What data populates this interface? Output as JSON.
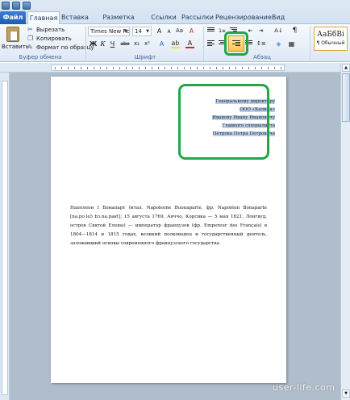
{
  "tabs": [
    "Файл",
    "Главная",
    "Вставка",
    "Разметка страницы",
    "Ссылки",
    "Рассылки",
    "Рецензирование",
    "Вид"
  ],
  "clipboard": {
    "paste": "Вставить",
    "cut": "Вырезать",
    "copy": "Копировать",
    "format": "Формат по образцу",
    "group": "Буфер обмена"
  },
  "font": {
    "name": "Times New Rom",
    "size": "14",
    "group": "Шрифт"
  },
  "paragraph": {
    "group": "Абзац"
  },
  "styles": {
    "sample": "АаБбВі",
    "name": "¶ Обычный"
  },
  "icons": {
    "bold": "Ж",
    "italic": "К",
    "underline": "Ч",
    "strike": "abe",
    "subscript": "x₂",
    "superscript": "x²",
    "pilcrow": "¶",
    "grow": "A",
    "shrink": "A",
    "case": "Aa",
    "clear": "A"
  },
  "address_lines": [
    "Генеральному директору",
    "ООО «Калина»",
    "Иванову Ивану Ивановичу",
    "Главного специалиста",
    "Петрова Петра Петровича"
  ],
  "body_text": "Наполеон I Бонапарт (итал. Napoleone Buonaparte, фр. Napoléon Bonaparte [na.po.leɔ̃ bɔ.na.paʁt]; 15 августа 1769, Аяччо, Корсика — 5 мая 1821, Лонгвуд, остров Святой Елены) — император французов (фр. Empereur des Français) в 1804—1814 и 1815 годах, великий полководец и государственный деятель, заложивший основы современного французского государства.",
  "watermark": "user-life.com"
}
